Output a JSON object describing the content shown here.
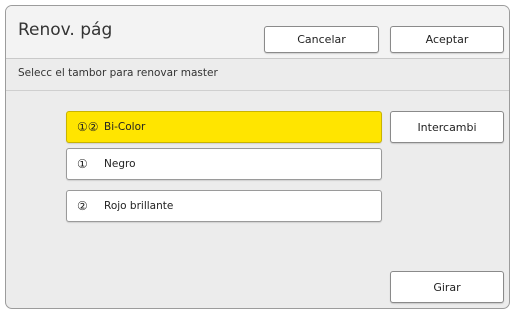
{
  "dialog": {
    "title": "Renov. pág",
    "cancel_label": "Cancelar",
    "accept_label": "Aceptar"
  },
  "instruction": "Selecc el tambor para renovar master",
  "drum_options": [
    {
      "number": "①②",
      "label": "Bi-Color",
      "selected": true
    },
    {
      "number": "①",
      "label": "Negro",
      "selected": false
    },
    {
      "number": "②",
      "label": "Rojo brillante",
      "selected": false
    }
  ],
  "swap_label": "Intercambi",
  "rotate_label": "Girar",
  "colors": {
    "selected_highlight": "#ffe500",
    "panel_background": "#ececec",
    "header_background": "#f3f3f3"
  }
}
